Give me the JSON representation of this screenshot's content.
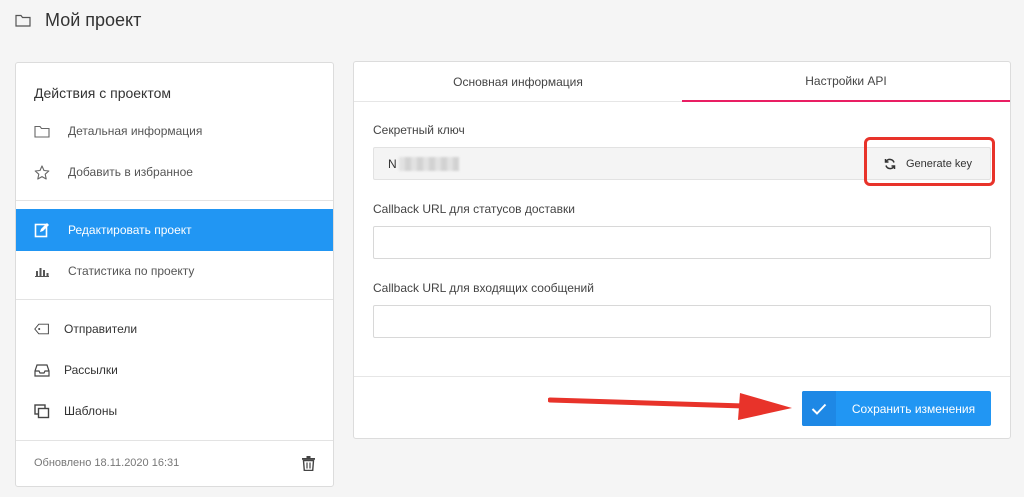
{
  "header": {
    "title": "Мой проект",
    "icon": "folder-icon"
  },
  "sidebar": {
    "heading": "Действия с проектом",
    "items": [
      {
        "label": "Детальная информация",
        "icon": "folder-icon"
      },
      {
        "label": "Добавить в избранное",
        "icon": "star-icon"
      },
      {
        "label": "Редактировать проект",
        "icon": "edit-icon",
        "active": true
      },
      {
        "label": "Статистика по проекту",
        "icon": "bar-chart-icon"
      },
      {
        "label": "Отправители",
        "icon": "tag-icon"
      },
      {
        "label": "Рассылки",
        "icon": "inbox-icon"
      },
      {
        "label": "Шаблоны",
        "icon": "templates-icon"
      }
    ],
    "updated": "Обновлено 18.11.2020 16:31"
  },
  "tabs": [
    {
      "label": "Основная информация",
      "active": false
    },
    {
      "label": "Настройки API",
      "active": true
    }
  ],
  "form": {
    "secret_key_label": "Секретный ключ",
    "secret_key_value": "N",
    "generate_key_label": "Generate key",
    "delivery_callback_label": "Callback URL для статусов доставки",
    "delivery_callback_value": "",
    "incoming_callback_label": "Callback URL для входящих сообщений",
    "incoming_callback_value": "",
    "save_label": "Сохранить изменения"
  },
  "colors": {
    "accent": "#2196f3",
    "tab_underline": "#e91e63",
    "annotation": "#e8332a"
  }
}
